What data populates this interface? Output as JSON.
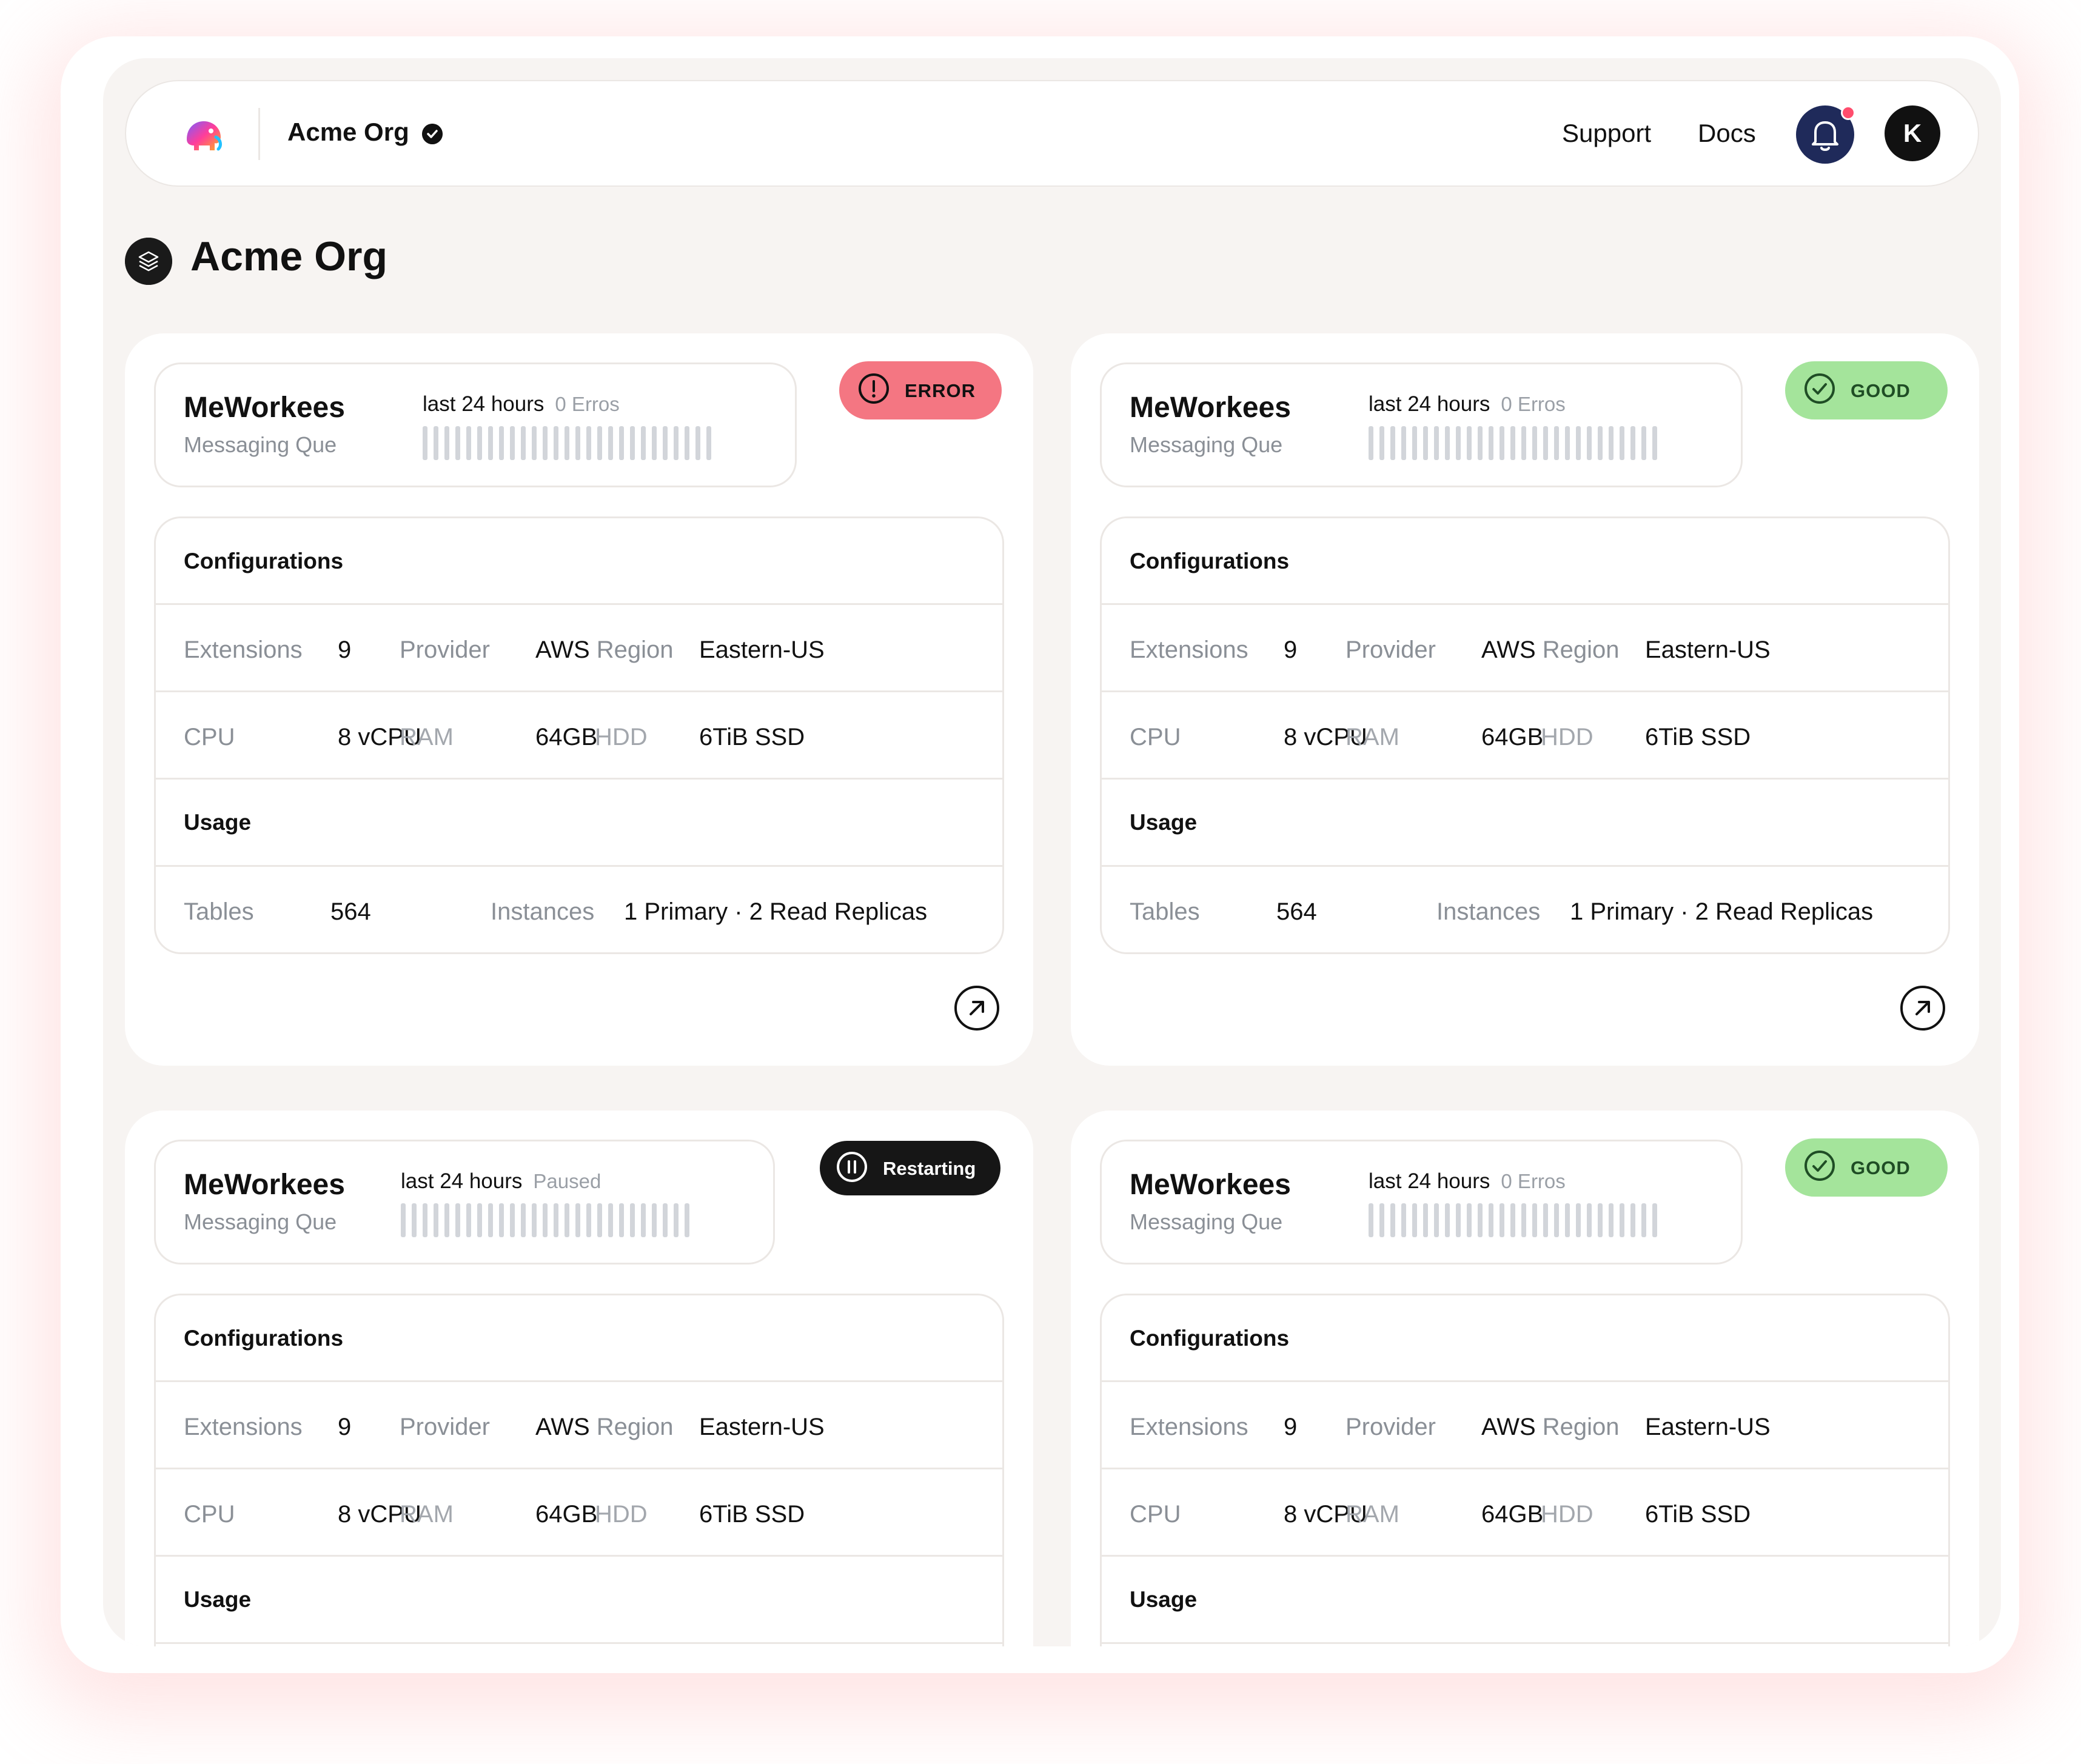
{
  "header": {
    "org_name": "Acme Org",
    "nav": {
      "support": "Support",
      "docs": "Docs"
    },
    "avatar_initial": "K",
    "icons": {
      "logo": "elephant-logo-icon",
      "verified": "verified-check-icon",
      "notifications": "bell-icon"
    }
  },
  "page": {
    "title": "Acme Org",
    "icon": "layers-icon"
  },
  "colors": {
    "error": "#f47682",
    "good": "#a4e49b",
    "restarting": "#161616",
    "accent": "#1f2a5a"
  },
  "cards": [
    {
      "name": "MeWorkees",
      "type": "Messaging Que",
      "period": "last 24 hours",
      "period_note": "0 Erros",
      "status": "ERROR",
      "config_title": "Configurations",
      "extensions_label": "Extensions",
      "extensions_value": "9",
      "provider_label": "Provider",
      "provider_value": "AWS",
      "region_label": "Region",
      "region_value": "Eastern-US",
      "cpu_label": "CPU",
      "cpu_value": "8 vCPU",
      "ram_label": "RAM",
      "ram_value": "64GB",
      "hdd_label": "HDD",
      "hdd_value": "6TiB SSD",
      "usage_title": "Usage",
      "tables_label": "Tables",
      "tables_value": "564",
      "instances_label": "Instances",
      "instances_value": "1 Primary · 2 Read Replicas"
    },
    {
      "name": "MeWorkees",
      "type": "Messaging Que",
      "period": "last 24 hours",
      "period_note": "0 Erros",
      "status": "GOOD",
      "config_title": "Configurations",
      "extensions_label": "Extensions",
      "extensions_value": "9",
      "provider_label": "Provider",
      "provider_value": "AWS",
      "region_label": "Region",
      "region_value": "Eastern-US",
      "cpu_label": "CPU",
      "cpu_value": "8 vCPU",
      "ram_label": "RAM",
      "ram_value": "64GB",
      "hdd_label": "HDD",
      "hdd_value": "6TiB SSD",
      "usage_title": "Usage",
      "tables_label": "Tables",
      "tables_value": "564",
      "instances_label": "Instances",
      "instances_value": "1 Primary · 2 Read Replicas"
    },
    {
      "name": "MeWorkees",
      "type": "Messaging Que",
      "period": "last 24 hours",
      "period_note": "Paused",
      "status": "Restarting",
      "config_title": "Configurations",
      "extensions_label": "Extensions",
      "extensions_value": "9",
      "provider_label": "Provider",
      "provider_value": "AWS",
      "region_label": "Region",
      "region_value": "Eastern-US",
      "cpu_label": "CPU",
      "cpu_value": "8 vCPU",
      "ram_label": "RAM",
      "ram_value": "64GB",
      "hdd_label": "HDD",
      "hdd_value": "6TiB SSD",
      "usage_title": "Usage"
    },
    {
      "name": "MeWorkees",
      "type": "Messaging Que",
      "period": "last 24 hours",
      "period_note": "0 Erros",
      "status": "GOOD",
      "config_title": "Configurations",
      "extensions_label": "Extensions",
      "extensions_value": "9",
      "provider_label": "Provider",
      "provider_value": "AWS",
      "region_label": "Region",
      "region_value": "Eastern-US",
      "cpu_label": "CPU",
      "cpu_value": "8 vCPU",
      "ram_label": "RAM",
      "ram_value": "64GB",
      "hdd_label": "HDD",
      "hdd_value": "6TiB SSD",
      "usage_title": "Usage"
    }
  ]
}
